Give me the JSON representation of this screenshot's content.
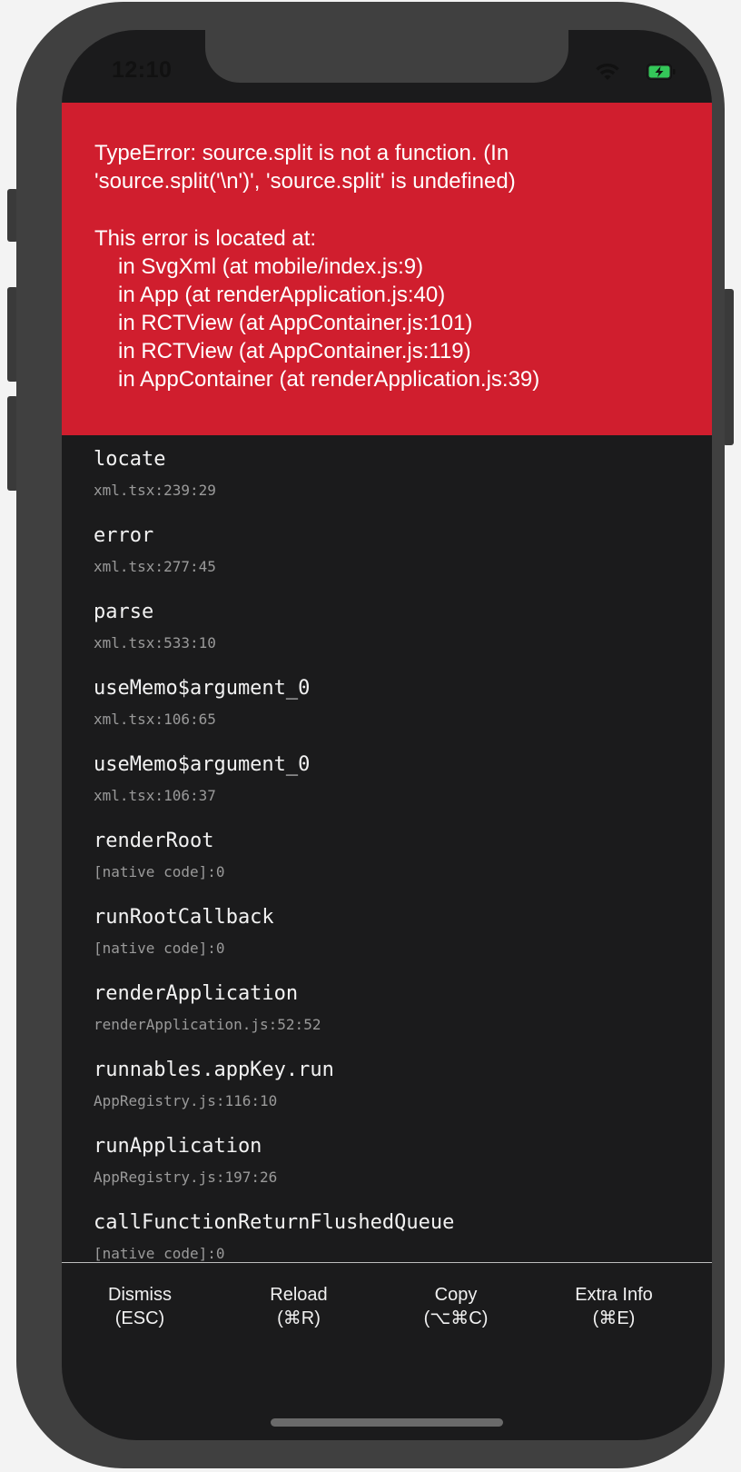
{
  "status_bar": {
    "time": "12:10",
    "battery_color": "#34c759"
  },
  "error": {
    "message": "TypeError: source.split is not a function. (In 'source.split('\\n')', 'source.split' is undefined)",
    "located_title": "This error is located at:",
    "component_stack": [
      "in SvgXml (at mobile/index.js:9)",
      "in App (at renderApplication.js:40)",
      "in RCTView (at AppContainer.js:101)",
      "in RCTView (at AppContainer.js:119)",
      "in AppContainer (at renderApplication.js:39)"
    ],
    "header_color": "#d01e2e"
  },
  "stack_trace": [
    {
      "fn": "locate",
      "loc": "xml.tsx:239:29"
    },
    {
      "fn": "error",
      "loc": "xml.tsx:277:45"
    },
    {
      "fn": "parse",
      "loc": "xml.tsx:533:10"
    },
    {
      "fn": "useMemo$argument_0",
      "loc": "xml.tsx:106:65"
    },
    {
      "fn": "useMemo$argument_0",
      "loc": "xml.tsx:106:37"
    },
    {
      "fn": "renderRoot",
      "loc": "[native code]:0"
    },
    {
      "fn": "runRootCallback",
      "loc": "[native code]:0"
    },
    {
      "fn": "renderApplication",
      "loc": "renderApplication.js:52:52"
    },
    {
      "fn": "runnables.appKey.run",
      "loc": "AppRegistry.js:116:10"
    },
    {
      "fn": "runApplication",
      "loc": "AppRegistry.js:197:26"
    },
    {
      "fn": "callFunctionReturnFlushedQueue",
      "loc": "[native code]:0"
    }
  ],
  "footer": {
    "buttons": [
      {
        "label": "Dismiss",
        "shortcut": "(ESC)"
      },
      {
        "label": "Reload",
        "shortcut": "(⌘R)"
      },
      {
        "label": "Copy",
        "shortcut": "(⌥⌘C)"
      },
      {
        "label": "Extra Info",
        "shortcut": "(⌘E)"
      }
    ]
  },
  "icons": [
    "wifi-icon",
    "battery-charging-icon"
  ]
}
